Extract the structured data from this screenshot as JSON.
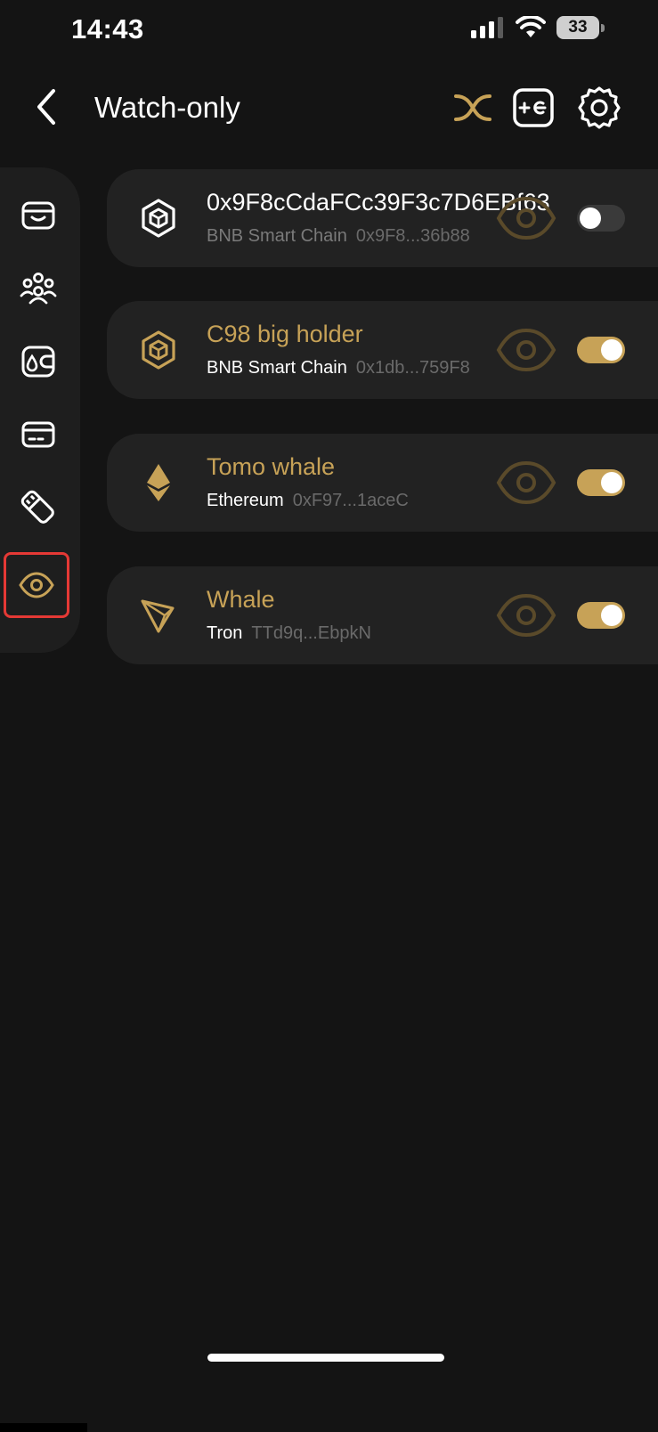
{
  "status_bar": {
    "time": "14:43",
    "battery": "33"
  },
  "header": {
    "title": "Watch-only",
    "back_icon": "chevron-left-icon",
    "actions": [
      "swap-icon",
      "add-wallet-icon",
      "gear-icon"
    ]
  },
  "sidebar": {
    "items": [
      {
        "icon": "wallet-icon"
      },
      {
        "icon": "group-icon"
      },
      {
        "icon": "wallet-drop-icon"
      },
      {
        "icon": "card-icon"
      },
      {
        "icon": "hardware-key-icon"
      },
      {
        "icon": "eye-icon",
        "active": true
      }
    ]
  },
  "wallets": [
    {
      "name": "0x9F8cCdaFCc39F3c7D6EBf63",
      "chain": "BNB Smart Chain",
      "address": "0x9F8...36b88",
      "chain_icon": "bnb-icon",
      "enabled": false
    },
    {
      "name": "C98 big holder",
      "chain": "BNB Smart Chain",
      "address": "0x1db...759F8",
      "chain_icon": "bnb-icon",
      "enabled": true
    },
    {
      "name": "Tomo whale",
      "chain": "Ethereum",
      "address": "0xF97...1aceC",
      "chain_icon": "ethereum-icon",
      "enabled": true
    },
    {
      "name": "Whale",
      "chain": "Tron",
      "address": "TTd9q...EbpkN",
      "chain_icon": "tron-icon",
      "enabled": true
    }
  ],
  "colors": {
    "background": "#141414",
    "card": "#222222",
    "accent": "#c7a257",
    "muted_text": "#6a6a6a",
    "highlight_border": "#e53935"
  }
}
